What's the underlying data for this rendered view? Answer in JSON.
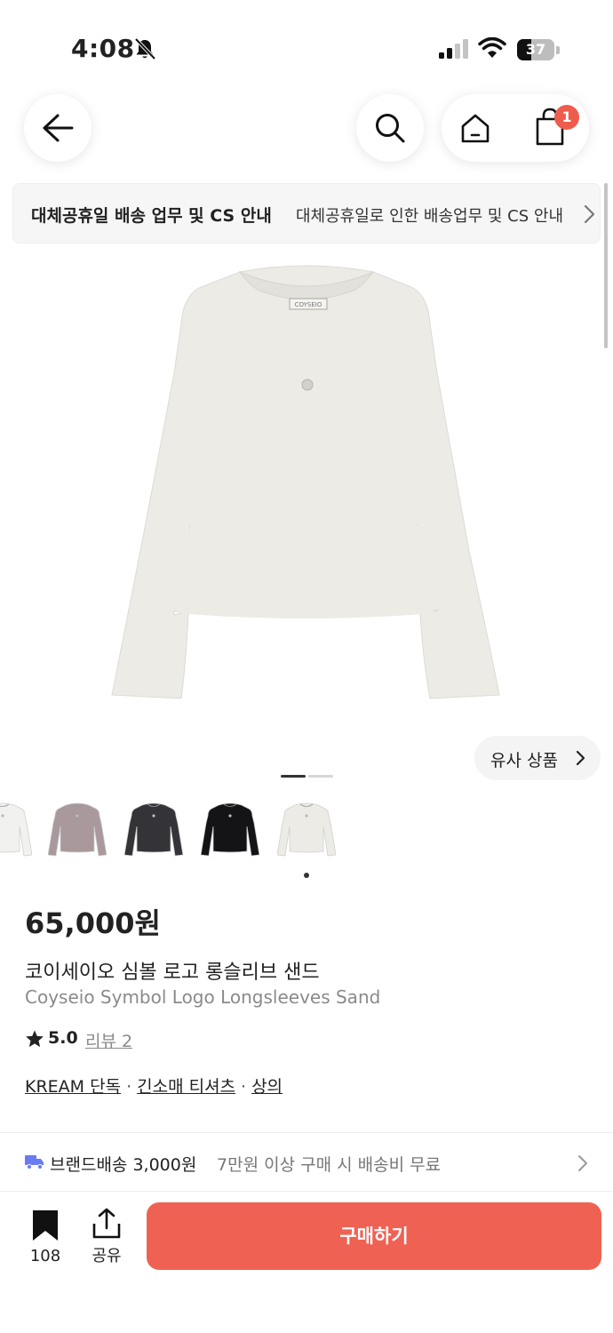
{
  "status_bar": {
    "time": "4:08",
    "battery": "37"
  },
  "nav": {
    "cart_count": "1"
  },
  "notice": {
    "title": "대체공휴일 배송 업무 및 CS 안내",
    "text": "대체공휴일로 인한 배송업무 및 CS 안내"
  },
  "similar_button": {
    "label": "유사 상품"
  },
  "thumbnails": [
    {
      "color": "white",
      "hex": "#f1f1ef"
    },
    {
      "color": "mauve",
      "hex": "#aa999c"
    },
    {
      "color": "charcoal",
      "hex": "#333338"
    },
    {
      "color": "black",
      "hex": "#141416"
    },
    {
      "color": "sand",
      "hex": "#ecebe6"
    }
  ],
  "product": {
    "price": "65,000원",
    "name_ko": "코이세이오 심볼 로고 롱슬리브 샌드",
    "name_en": "Coyseio Symbol Logo Longsleeves Sand",
    "rating": "5.0",
    "review_label": "리뷰 2",
    "label_text": "COYSEIO",
    "tags": [
      "KREAM 단독",
      "긴소매 티셔츠",
      "상의"
    ]
  },
  "shipping": {
    "main": "브랜드배송 3,000원",
    "sub": "7만원 이상 구매 시 배송비 무료"
  },
  "bottom_bar": {
    "bookmark_count": "108",
    "share_label": "공유",
    "buy_label": "구매하기"
  },
  "colors": {
    "accent": "#ef6253",
    "badge": "#ef5b4c",
    "shirt": "#ecebe6"
  }
}
